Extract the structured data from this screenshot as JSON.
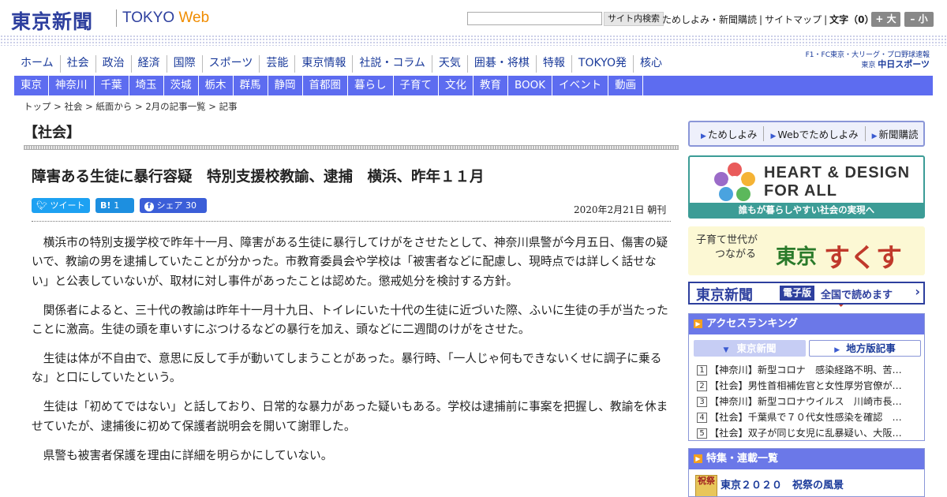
{
  "header": {
    "logo": "東京新聞",
    "logo_sub": "TOKYO",
    "logo_web": "Web",
    "search_button": "サイト内検索",
    "links": [
      "ためしよみ・新聞購読",
      "サイトマップ"
    ],
    "font_label": "文字（0）",
    "font_plus": "+ 大",
    "font_minus": "– 小",
    "chunichi_top": "F1・FC東京・大リーグ・プロ野球速報",
    "chunichi_small": "東京",
    "chunichi_main": "中日スポーツ"
  },
  "nav_main": [
    "ホーム",
    "社会",
    "政治",
    "経済",
    "国際",
    "スポーツ",
    "芸能",
    "東京情報",
    "社説・コラム",
    "天気",
    "囲碁・将棋",
    "特報",
    "TOKYO発",
    "核心"
  ],
  "nav_sub": [
    "東京",
    "神奈川",
    "千葉",
    "埼玉",
    "茨城",
    "栃木",
    "群馬",
    "静岡",
    "首都圏",
    "暮らし",
    "子育て",
    "文化",
    "教育",
    "BOOK",
    "イベント",
    "動画"
  ],
  "breadcrumb": "トップ > 社会 > 紙面から > 2月の記事一覧 > 記事",
  "section": "【社会】",
  "article": {
    "title": "障害ある生徒に暴行容疑　特別支援校教諭、逮捕　横浜、昨年１１月",
    "tweet": "ツイート",
    "hatena": "B!",
    "hatena_count": "1",
    "share": "シェア",
    "share_count": "30",
    "date": "2020年2月21日 朝刊",
    "paragraphs": [
      "横浜市の特別支援学校で昨年十一月、障害がある生徒に暴行してけがをさせたとして、神奈川県警が今月五日、傷害の疑いで、教諭の男を逮捕していたことが分かった。市教育委員会や学校は「被害者などに配慮し、現時点では詳しく話せない」と公表していないが、取材に対し事件があったことは認めた。懲戒処分を検討する方針。",
      "関係者によると、三十代の教諭は昨年十一月十九日、トイレにいた十代の生徒に近づいた際、ふいに生徒の手が当たったことに激高。生徒の頭を車いすにぶつけるなどの暴行を加え、頭などに二週間のけがをさせた。",
      "生徒は体が不自由で、意思に反して手が動いてしまうことがあった。暴行時、「一人じゃ何もできないくせに調子に乗るな」と口にしていたという。",
      "生徒は「初めてではない」と話しており、日常的な暴力があった疑いもある。学校は逮捕前に事案を把握し、教諭を休ませていたが、逮捕後に初めて保護者説明会を開いて謝罪した。",
      "県警も被害者保護を理由に詳細を明らかにしていない。"
    ]
  },
  "sidebar": {
    "trial": [
      "ためしよみ",
      "Webでためしよみ",
      "新聞購読"
    ],
    "heart_line1": "HEART & DESIGN",
    "heart_line2": "FOR ALL",
    "heart_bar": "誰もが暮らしやすい社会の実現へ",
    "sukusuku_text1": "子育て世代が",
    "sukusuku_text2": "つながる",
    "sukusuku_tokyo": "東京",
    "sukusuku_logo": "すくすく",
    "denshi_name": "東京新聞",
    "denshi_tag": "電子版",
    "denshi_text": "全国で読めます",
    "ranking_title": "アクセスランキング",
    "ranking_tab1": "東京新聞",
    "ranking_tab2": "地方版記事",
    "ranking": [
      "【神奈川】新型コロナ　感染経路不明、苦…",
      "【社会】男性首相補佐官と女性厚労官僚が…",
      "【神奈川】新型コロナウイルス　川崎市長…",
      "【社会】千葉県で７０代女性感染を確認　…",
      "【社会】双子が同じ女児に乱暴疑い、大阪…"
    ],
    "special_title": "特集・連載一覧",
    "special_item": "東京２０２０　祝祭の風景",
    "special_img": "祝祭"
  },
  "colors": {
    "nav_bar": "#5d6cf0",
    "brand": "#2d3f9e",
    "accent": "#f08c00"
  }
}
